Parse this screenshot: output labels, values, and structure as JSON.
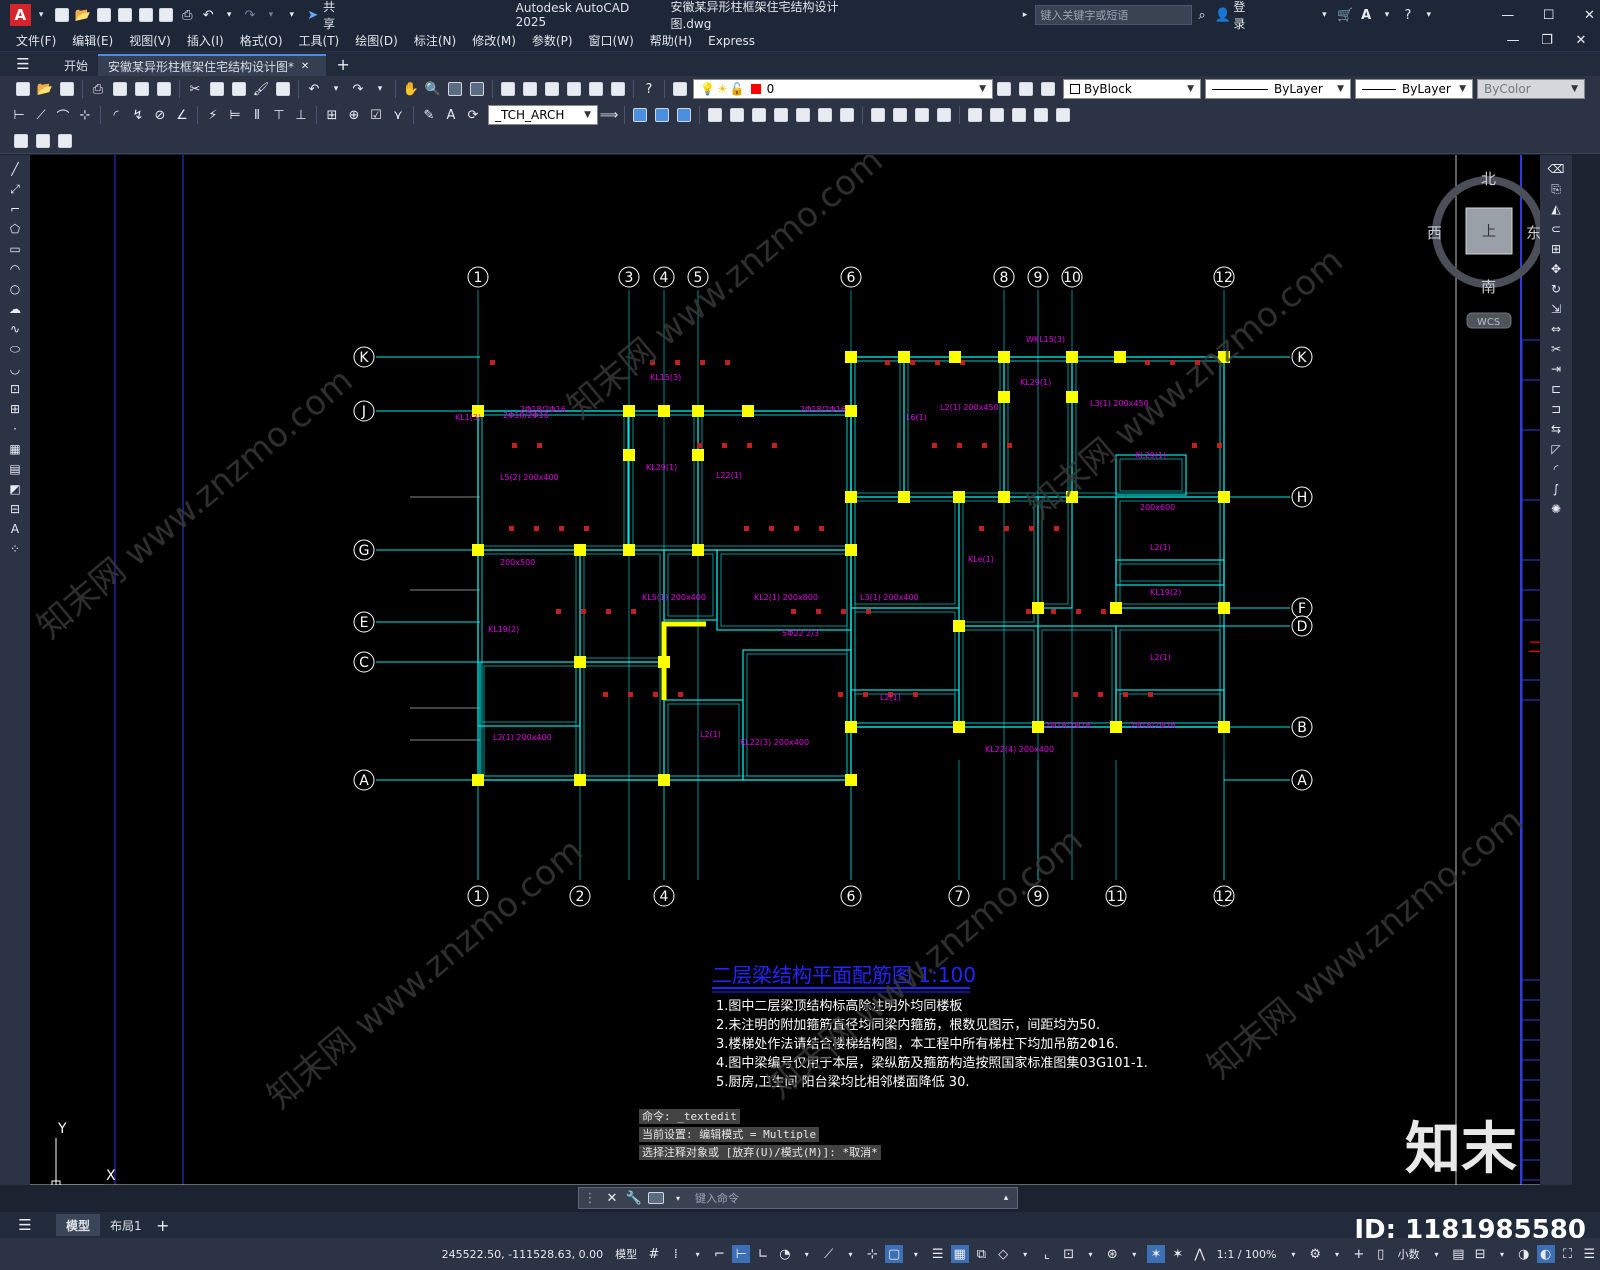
{
  "window": {
    "app_title": "Autodesk AutoCAD 2025",
    "file_title": "安徽某异形柱框架住宅结构设计图.dwg",
    "search_placeholder": "键入关键字或短语",
    "login": "登录",
    "share": "共享"
  },
  "menu": [
    "文件(F)",
    "编辑(E)",
    "视图(V)",
    "插入(I)",
    "格式(O)",
    "工具(T)",
    "绘图(D)",
    "标注(N)",
    "修改(M)",
    "参数(P)",
    "窗口(W)",
    "帮助(H)",
    "Express"
  ],
  "tabs": {
    "start": "开始",
    "doc": "安徽某异形柱框架住宅结构设计图*"
  },
  "props": {
    "layer": "0",
    "color": "ByBlock",
    "linetype": "ByLayer",
    "lineweight": "ByLayer",
    "plotstyle": "ByColor",
    "textstyle": "_TCH_ARCH"
  },
  "colors": {
    "cyan": "#00e5e5",
    "magenta": "#e000e0",
    "yellow": "#ffff00",
    "blue_title": "#2424ff",
    "red_layer": "#ff0000"
  },
  "viewcube": {
    "north": "北",
    "south": "南",
    "east": "东",
    "west": "西",
    "top": "上",
    "wcs": "WCS"
  },
  "drawing": {
    "title": "二层梁结构平面配筋图  1:100",
    "notes": [
      "1.图中二层梁顶结构标高除注明外均同楼板",
      "2.未注明的附加箍筋直径均同梁内箍筋，根数见图示，间距均为50.",
      "3.楼梯处作法请结合楼梯结构图，本工程中所有梯柱下均加吊筋2Φ16.",
      "4.图中梁编号仅用于本层，梁纵筋及箍筋构造按照国家标准图集03G101-1.",
      "5.厨房,卫生间 阳台梁均比相邻楼面降低 30."
    ],
    "axes_top": [
      "1",
      "3",
      "4",
      "5",
      "6",
      "8",
      "9",
      "10",
      "12"
    ],
    "axes_bottom": [
      "1",
      "2",
      "4",
      "6",
      "7",
      "9",
      "11",
      "12"
    ],
    "axes_left": [
      "K",
      "J",
      "G",
      "E",
      "C",
      "A"
    ],
    "axes_right": [
      "K",
      "H",
      "F",
      "D",
      "B",
      "A"
    ],
    "ucs_y": "Y",
    "ucs_x": "X",
    "side_labels": [
      "二层梁"
    ],
    "watermark": "知末网 www.znzmo.com",
    "brand": "知末",
    "id_label": "ID: 1181985580"
  },
  "command": {
    "line1": "命令: _textedit",
    "line2": "当前设置: 编辑模式 = Multiple",
    "line3": "选择注释对象或 [放弃(U)/模式(M)]: *取消*",
    "placeholder": "键入命令"
  },
  "layouts": {
    "model": "模型",
    "layout1": "布局1"
  },
  "status": {
    "coords": "245522.50, -111528.63, 0.00",
    "mode": "模型",
    "scale": "1:1 / 100%",
    "units": "小数"
  }
}
